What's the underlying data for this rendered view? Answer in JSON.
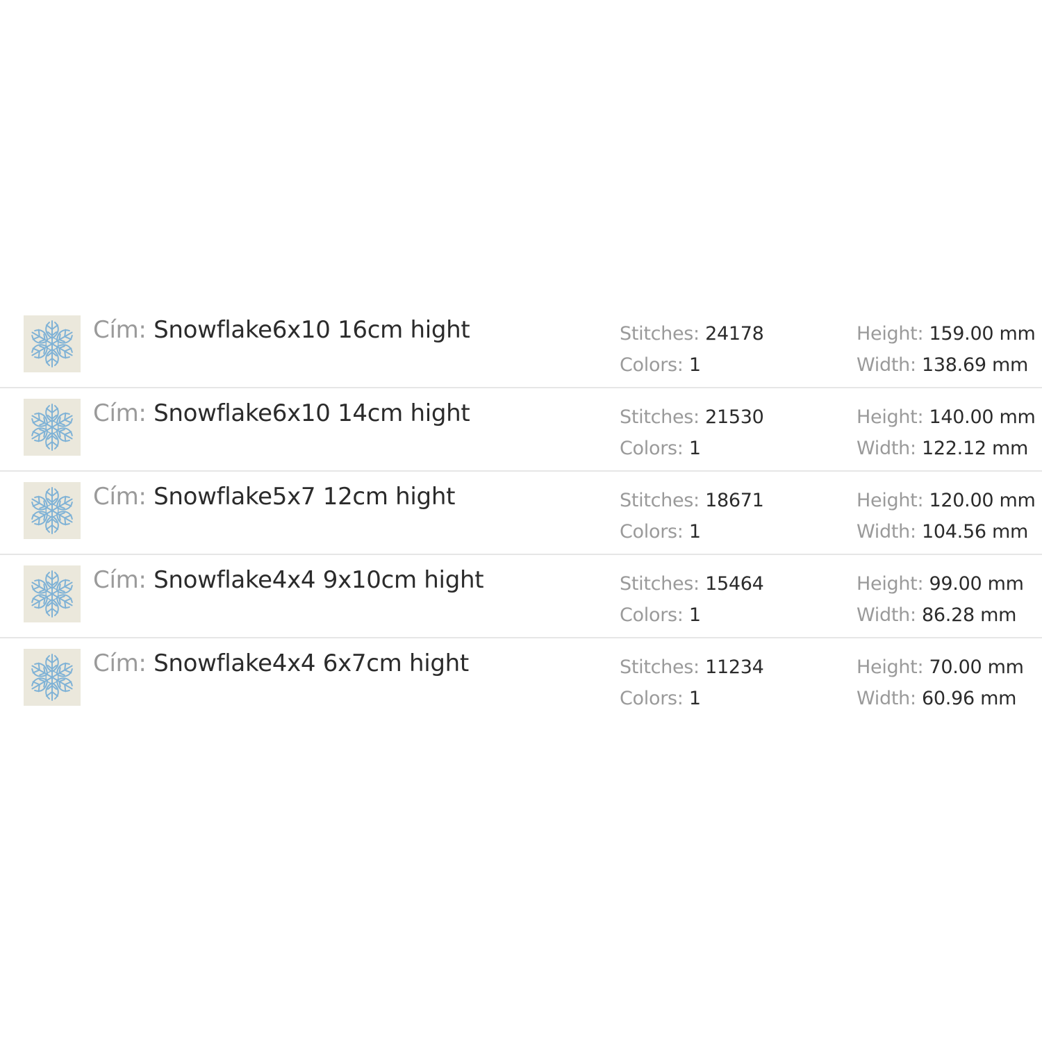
{
  "labels": {
    "name": "Cím:",
    "stitches": "Stitches:",
    "colors": "Colors:",
    "height": "Height:",
    "width": "Width:"
  },
  "icon": "snowflake-icon",
  "accent_color": "#7fb2d6",
  "items": [
    {
      "name": "Snowflake6x10 16cm hight",
      "stitches": "24178",
      "colors": "1",
      "height": "159.00 mm",
      "width": "138.69 mm"
    },
    {
      "name": "Snowflake6x10 14cm hight",
      "stitches": "21530",
      "colors": "1",
      "height": "140.00 mm",
      "width": "122.12 mm"
    },
    {
      "name": "Snowflake5x7 12cm hight",
      "stitches": "18671",
      "colors": "1",
      "height": "120.00 mm",
      "width": "104.56 mm"
    },
    {
      "name": "Snowflake4x4 9x10cm hight",
      "stitches": "15464",
      "colors": "1",
      "height": "99.00 mm",
      "width": "86.28 mm"
    },
    {
      "name": "Snowflake4x4 6x7cm hight",
      "stitches": "11234",
      "colors": "1",
      "height": "70.00 mm",
      "width": "60.96 mm"
    }
  ]
}
